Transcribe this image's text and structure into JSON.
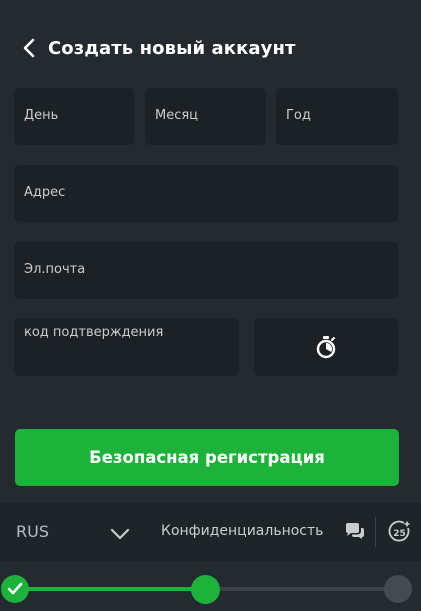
{
  "header": {
    "title": "Создать новый аккаунт",
    "back_icon": "chevron-left-icon"
  },
  "form": {
    "day_label": "День",
    "month_label": "Месяц",
    "year_label": "Год",
    "address_label": "Адрес",
    "email_label": "Эл.почта",
    "code_label": "код подтверждения",
    "timer_icon": "stopwatch-icon"
  },
  "submit": {
    "label": "Безопасная регистрация"
  },
  "footer": {
    "language": "RUS",
    "privacy_label": "Конфиденциальность",
    "chat_icon": "chat-bubbles-icon",
    "age_badge": "25"
  },
  "progress": {
    "current_step": 2,
    "total_steps": 3,
    "fill_fraction": 0.5
  },
  "colors": {
    "background": "#232a30",
    "field": "#1b2125",
    "accent": "#1db33a",
    "footer": "#1e2529"
  }
}
